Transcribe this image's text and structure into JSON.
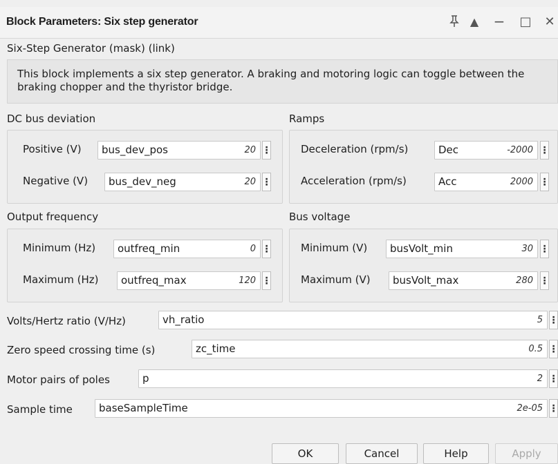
{
  "window": {
    "title": "Block Parameters: Six step generator",
    "controls": {
      "pin": "⁤",
      "collapse": "▲",
      "minimize": "−",
      "maximize": "□",
      "close": "✕"
    }
  },
  "block": {
    "heading": "Six-Step Generator (mask) (link)",
    "description": "This block implements a six step generator. A braking and motoring logic can toggle between the braking chopper and the thyristor bridge."
  },
  "groups": {
    "dc_bus_deviation": {
      "label": "DC bus deviation",
      "params": [
        {
          "label": "Positive (V)",
          "expr": "bus_dev_pos",
          "value": "20"
        },
        {
          "label": "Negative (V)",
          "expr": "bus_dev_neg",
          "value": "20"
        }
      ]
    },
    "ramps": {
      "label": "Ramps",
      "params": [
        {
          "label": "Deceleration (rpm/s)",
          "expr": "Dec",
          "value": "-2000"
        },
        {
          "label": "Acceleration (rpm/s)",
          "expr": "Acc",
          "value": "2000"
        }
      ]
    },
    "output_frequency": {
      "label": "Output frequency",
      "params": [
        {
          "label": "Minimum (Hz)",
          "expr": "outfreq_min",
          "value": "0"
        },
        {
          "label": "Maximum (Hz)",
          "expr": "outfreq_max",
          "value": "120"
        }
      ]
    },
    "bus_voltage": {
      "label": "Bus voltage",
      "params": [
        {
          "label": "Minimum (V)",
          "expr": "busVolt_min",
          "value": "30"
        },
        {
          "label": "Maximum (V)",
          "expr": "busVolt_max",
          "value": "280"
        }
      ]
    }
  },
  "params": {
    "vh_ratio": {
      "label": "Volts/Hertz ratio (V/Hz)",
      "expr": "vh_ratio",
      "value": "5"
    },
    "zc_time": {
      "label": "Zero speed crossing time (s)",
      "expr": "zc_time",
      "value": "0.5"
    },
    "pole_pairs": {
      "label": "Motor pairs of poles",
      "expr": "p",
      "value": "2"
    },
    "sample_time": {
      "label": "Sample time",
      "expr": "baseSampleTime",
      "value": "2e-05"
    }
  },
  "kebab_glyph": "⋮",
  "buttons": {
    "ok": "OK",
    "cancel": "Cancel",
    "help": "Help",
    "apply": "Apply"
  },
  "colors": {
    "dialog_bg": "#efefef",
    "field_bg": "#ffffff",
    "disabled_text": "#a9a9a9"
  }
}
